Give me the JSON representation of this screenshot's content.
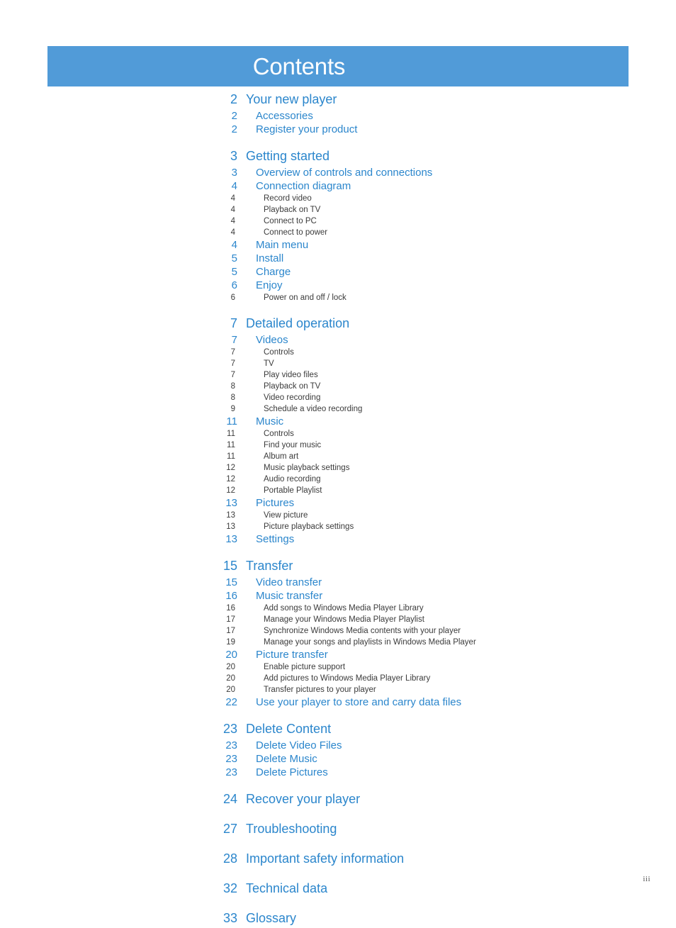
{
  "header": {
    "title": "Contents",
    "banner_color": "#519BD8",
    "title_color": "#FFFFFF"
  },
  "colors": {
    "accent_blue": "#2B86CC",
    "banner_blue": "#519BD8",
    "level3_text": "#3B3B3B"
  },
  "footer": {
    "page_number": "iii"
  },
  "toc": {
    "entries": [
      {
        "page": "2",
        "label": "Your new player",
        "level": 1,
        "section_start": false
      },
      {
        "page": "2",
        "label": "Accessories",
        "level": 2,
        "section_start": false
      },
      {
        "page": "2",
        "label": "Register your product",
        "level": 2,
        "section_start": false
      },
      {
        "page": "3",
        "label": "Getting started",
        "level": 1,
        "section_start": true
      },
      {
        "page": "3",
        "label": "Overview of controls and connections",
        "level": 2,
        "section_start": false
      },
      {
        "page": "4",
        "label": "Connection diagram",
        "level": 2,
        "section_start": false
      },
      {
        "page": "4",
        "label": "Record video",
        "level": 3,
        "section_start": false
      },
      {
        "page": "4",
        "label": "Playback on TV",
        "level": 3,
        "section_start": false
      },
      {
        "page": "4",
        "label": "Connect to PC",
        "level": 3,
        "section_start": false
      },
      {
        "page": "4",
        "label": "Connect to power",
        "level": 3,
        "section_start": false
      },
      {
        "page": "4",
        "label": "Main menu",
        "level": 2,
        "section_start": false
      },
      {
        "page": "5",
        "label": "Install",
        "level": 2,
        "section_start": false
      },
      {
        "page": "5",
        "label": "Charge",
        "level": 2,
        "section_start": false
      },
      {
        "page": "6",
        "label": "Enjoy",
        "level": 2,
        "section_start": false
      },
      {
        "page": "6",
        "label": "Power on and off / lock",
        "level": 3,
        "section_start": false
      },
      {
        "page": "7",
        "label": "Detailed operation",
        "level": 1,
        "section_start": true
      },
      {
        "page": "7",
        "label": "Videos",
        "level": 2,
        "section_start": false
      },
      {
        "page": "7",
        "label": "Controls",
        "level": 3,
        "section_start": false
      },
      {
        "page": "7",
        "label": "TV",
        "level": 3,
        "section_start": false
      },
      {
        "page": "7",
        "label": "Play video files",
        "level": 3,
        "section_start": false
      },
      {
        "page": "8",
        "label": "Playback on TV",
        "level": 3,
        "section_start": false
      },
      {
        "page": "8",
        "label": "Video recording",
        "level": 3,
        "section_start": false
      },
      {
        "page": "9",
        "label": "Schedule a video recording",
        "level": 3,
        "section_start": false
      },
      {
        "page": "11",
        "label": "Music",
        "level": 2,
        "section_start": false
      },
      {
        "page": "11",
        "label": "Controls",
        "level": 3,
        "section_start": false
      },
      {
        "page": "11",
        "label": "Find your music",
        "level": 3,
        "section_start": false
      },
      {
        "page": "11",
        "label": "Album art",
        "level": 3,
        "section_start": false
      },
      {
        "page": "12",
        "label": "Music playback settings",
        "level": 3,
        "section_start": false
      },
      {
        "page": "12",
        "label": "Audio recording",
        "level": 3,
        "section_start": false
      },
      {
        "page": "12",
        "label": "Portable Playlist",
        "level": 3,
        "section_start": false
      },
      {
        "page": "13",
        "label": "Pictures",
        "level": 2,
        "section_start": false
      },
      {
        "page": "13",
        "label": "View picture",
        "level": 3,
        "section_start": false
      },
      {
        "page": "13",
        "label": "Picture playback settings",
        "level": 3,
        "section_start": false
      },
      {
        "page": "13",
        "label": "Settings",
        "level": 2,
        "section_start": false
      },
      {
        "page": "15",
        "label": "Transfer",
        "level": 1,
        "section_start": true
      },
      {
        "page": "15",
        "label": "Video transfer",
        "level": 2,
        "section_start": false
      },
      {
        "page": "16",
        "label": "Music transfer",
        "level": 2,
        "section_start": false
      },
      {
        "page": "16",
        "label": "Add songs to Windows Media Player Library",
        "level": 3,
        "section_start": false
      },
      {
        "page": "17",
        "label": "Manage your Windows Media Player Playlist",
        "level": 3,
        "section_start": false
      },
      {
        "page": "17",
        "label": "Synchronize Windows Media contents with your player",
        "level": 3,
        "section_start": false
      },
      {
        "page": "19",
        "label": "Manage your songs and playlists in Windows Media Player",
        "level": 3,
        "section_start": false
      },
      {
        "page": "20",
        "label": "Picture transfer",
        "level": 2,
        "section_start": false
      },
      {
        "page": "20",
        "label": "Enable picture support",
        "level": 3,
        "section_start": false
      },
      {
        "page": "20",
        "label": "Add pictures to Windows Media Player Library",
        "level": 3,
        "section_start": false
      },
      {
        "page": "20",
        "label": "Transfer pictures to your player",
        "level": 3,
        "section_start": false
      },
      {
        "page": "22",
        "label": "Use your player to store and carry data files",
        "level": 2,
        "section_start": false
      },
      {
        "page": "23",
        "label": "Delete Content",
        "level": 1,
        "section_start": true
      },
      {
        "page": "23",
        "label": "Delete Video Files",
        "level": 2,
        "section_start": false
      },
      {
        "page": "23",
        "label": "Delete Music",
        "level": 2,
        "section_start": false
      },
      {
        "page": "23",
        "label": "Delete Pictures",
        "level": 2,
        "section_start": false
      },
      {
        "page": "24",
        "label": "Recover your player",
        "level": 1,
        "section_start": true
      },
      {
        "page": "27",
        "label": "Troubleshooting",
        "level": 1,
        "section_start": true
      },
      {
        "page": "28",
        "label": "Important safety information",
        "level": 1,
        "section_start": true
      },
      {
        "page": "32",
        "label": "Technical data",
        "level": 1,
        "section_start": true
      },
      {
        "page": "33",
        "label": "Glossary",
        "level": 1,
        "section_start": true
      }
    ]
  }
}
